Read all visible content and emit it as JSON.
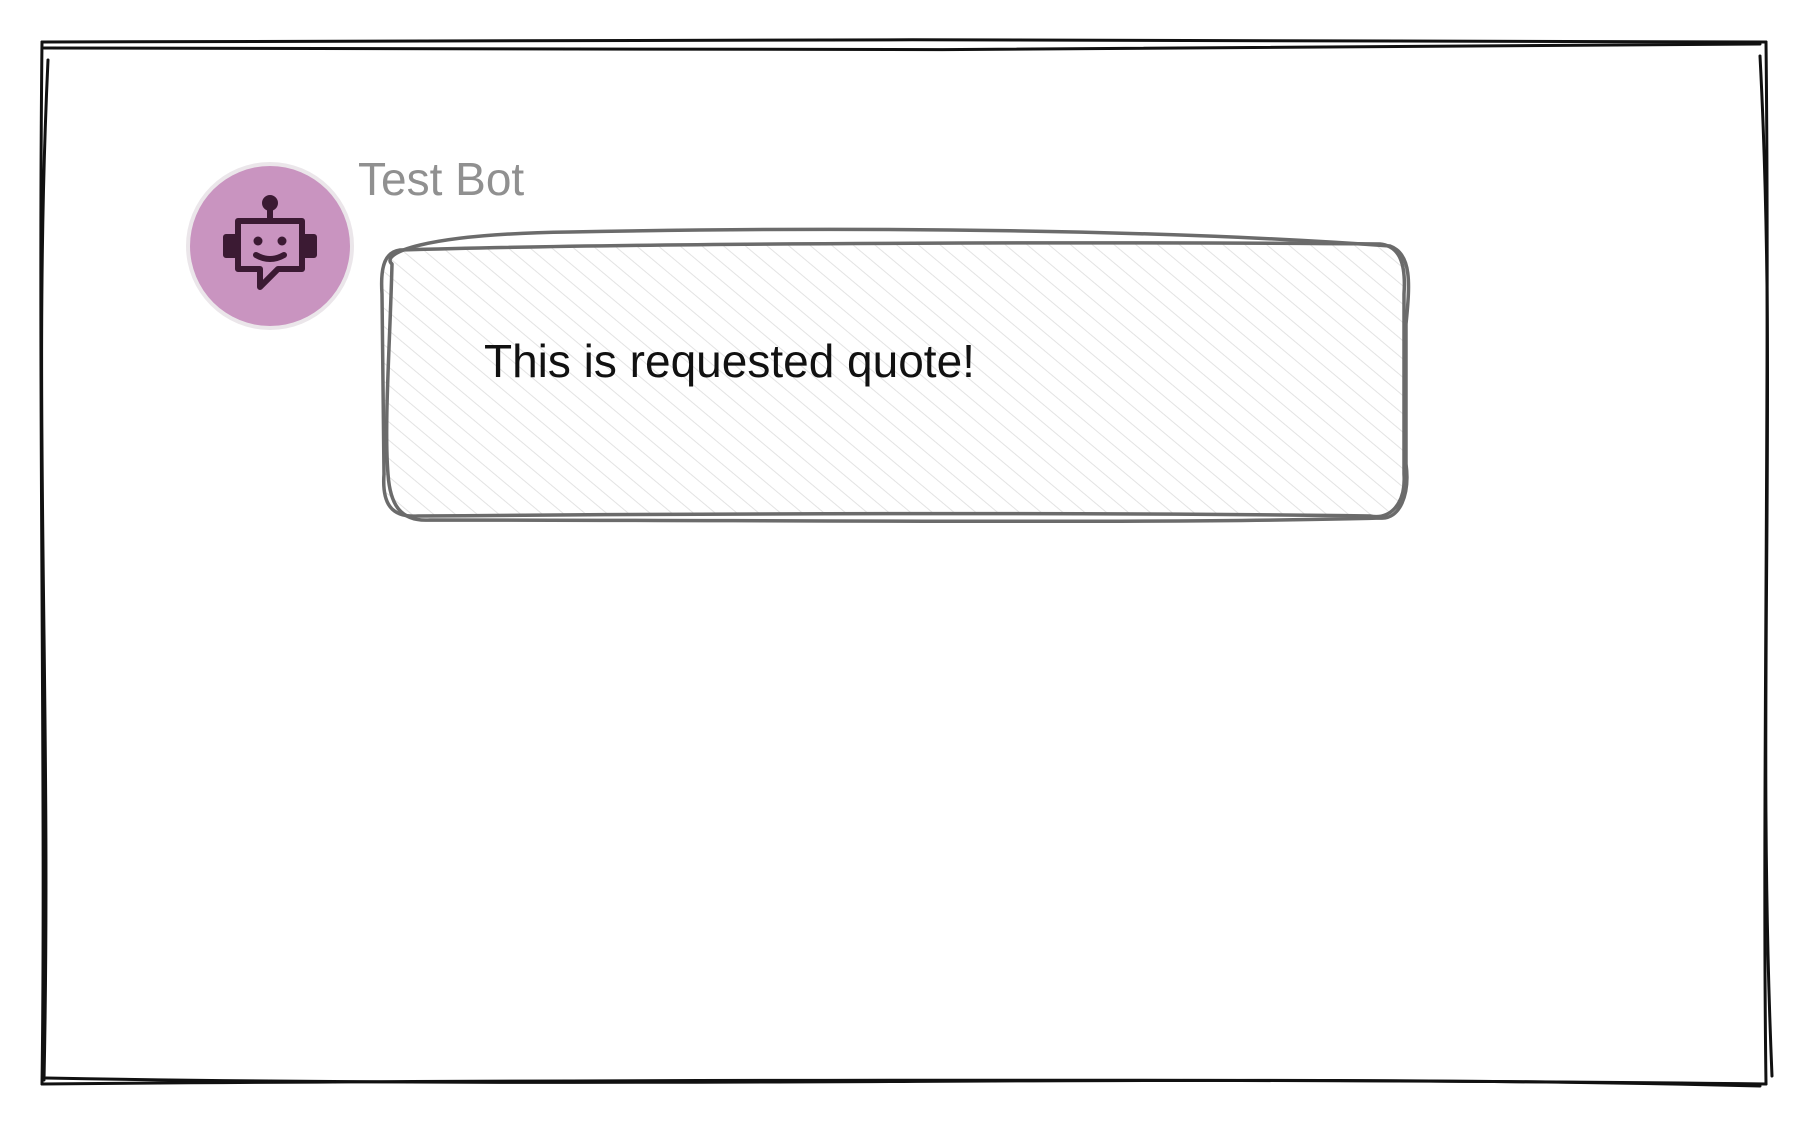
{
  "chat": {
    "sender_name": "Test Bot",
    "message_text": "This is requested quote!",
    "avatar_icon": "robot-chat-icon"
  },
  "colors": {
    "avatar_background": "#c994c0",
    "avatar_ring": "#ebe6ea",
    "sender_text": "#909090",
    "message_text": "#111111",
    "bubble_outline": "#6b6b6b",
    "frame_outline": "#111111"
  }
}
